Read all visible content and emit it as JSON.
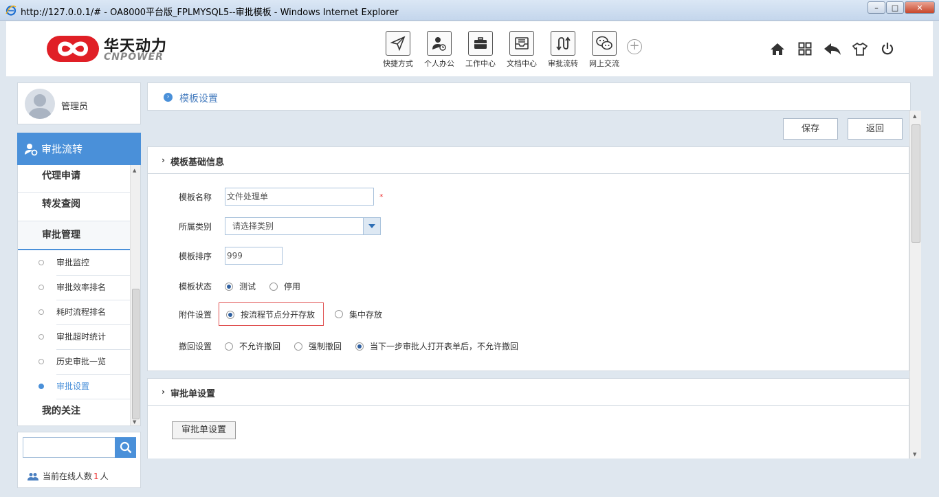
{
  "window": {
    "title": "http://127.0.0.1/# - OA8000平台版_FPLMYSQL5--审批模板 - Windows Internet Explorer",
    "minimize": "–",
    "maximize": "□",
    "close": "✕"
  },
  "brand": {
    "name_cn": "华天动力",
    "name_en": "CNPOWER",
    "colors": {
      "logo_red": "#e01f26",
      "accent": "#4a90d9"
    }
  },
  "nav": {
    "items": [
      {
        "label": "快捷方式",
        "icon": "send-icon"
      },
      {
        "label": "个人办公",
        "icon": "user-clock-icon"
      },
      {
        "label": "工作中心",
        "icon": "briefcase-icon"
      },
      {
        "label": "文档中心",
        "icon": "inbox-icon"
      },
      {
        "label": "审批流转",
        "icon": "flow-arrows-icon"
      },
      {
        "label": "网上交流",
        "icon": "chat-icon"
      }
    ],
    "add": "+"
  },
  "toolbar": {
    "icons": [
      "home-icon",
      "grid-icon",
      "reply-icon",
      "shirt-icon",
      "power-icon"
    ]
  },
  "user": {
    "name": "管理员"
  },
  "sidebar": {
    "module": "审批流转",
    "items": [
      {
        "label": "代理申请"
      },
      {
        "label": "转发查阅"
      },
      {
        "label": "审批管理"
      },
      {
        "label": "审批监控"
      },
      {
        "label": "审批效率排名"
      },
      {
        "label": "耗时流程排名"
      },
      {
        "label": "审批超时统计"
      },
      {
        "label": "历史审批一览"
      },
      {
        "label": "审批设置"
      },
      {
        "label": "我的关注"
      }
    ]
  },
  "search": {
    "value": "",
    "placeholder": ""
  },
  "online": {
    "prefix": "当前在线人数",
    "count": "1",
    "suffix": "人"
  },
  "breadcrumb": {
    "title": "模板设置"
  },
  "actions": {
    "save": "保存",
    "back": "返回"
  },
  "basic": {
    "title": "模板基础信息",
    "name_label": "模板名称",
    "name_value": "文件处理单",
    "required_mark": "*",
    "category_label": "所属类别",
    "category_value": "请选择类别",
    "order_label": "模板排序",
    "order_value": "999",
    "status_label": "模板状态",
    "status_options": [
      "测试",
      "停用"
    ],
    "attach_label": "附件设置",
    "attach_options": [
      "按流程节点分开存放",
      "集中存放"
    ],
    "recall_label": "撤回设置",
    "recall_options": [
      "不允许撤回",
      "强制撤回",
      "当下一步审批人打开表单后，不允许撤回"
    ]
  },
  "form_settings": {
    "title": "审批单设置",
    "button": "审批单设置"
  }
}
